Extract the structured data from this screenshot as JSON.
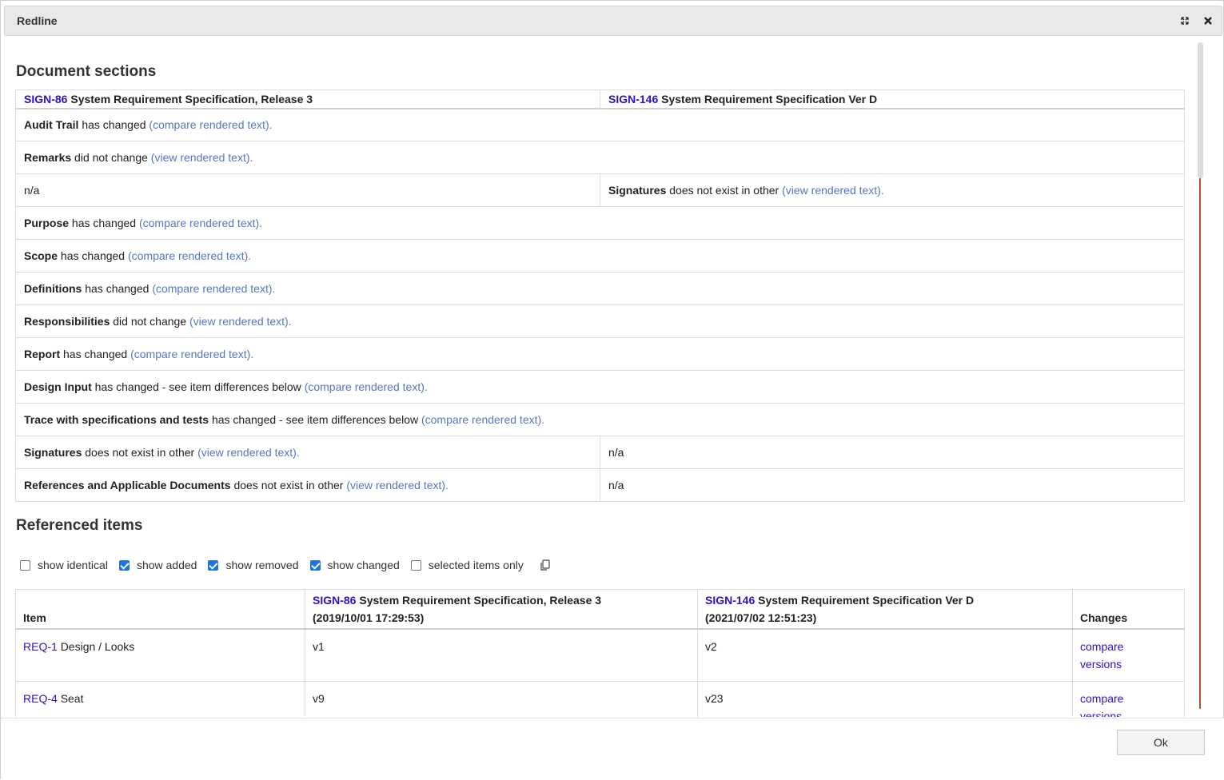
{
  "dialog": {
    "title": "Redline",
    "ok_label": "Ok"
  },
  "sections": {
    "heading": "Document sections",
    "left_doc": {
      "id": "SIGN-86",
      "title": "System Requirement Specification, Release 3"
    },
    "right_doc": {
      "id": "SIGN-146",
      "title": "System Requirement Specification Ver D"
    },
    "rows": [
      {
        "name": "Audit Trail",
        "status": "has changed",
        "link": "(compare rendered text)."
      },
      {
        "name": "Remarks",
        "status": "did not change",
        "link": "(view rendered text)."
      },
      {
        "left": "n/a",
        "name": "Signatures",
        "status": "does not exist in other",
        "link": "(view rendered text)."
      },
      {
        "name": "Purpose",
        "status": "has changed",
        "link": "(compare rendered text)."
      },
      {
        "name": "Scope",
        "status": "has changed",
        "link": "(compare rendered text)."
      },
      {
        "name": "Definitions",
        "status": "has changed",
        "link": "(compare rendered text)."
      },
      {
        "name": "Responsibilities",
        "status": "did not change",
        "link": "(view rendered text)."
      },
      {
        "name": "Report",
        "status": "has changed",
        "link": "(compare rendered text)."
      },
      {
        "name": "Design Input",
        "status": "has changed - see item differences below",
        "link": "(compare rendered text)."
      },
      {
        "name": "Trace with specifications and tests",
        "status": "has changed - see item differences below",
        "link": "(compare rendered text)."
      },
      {
        "name": "Signatures",
        "status": "does not exist in other",
        "link": "(view rendered text).",
        "right": "n/a"
      },
      {
        "name": "References and Applicable Documents",
        "status": "does not exist in other",
        "link": "(view rendered text).",
        "right": "n/a"
      }
    ]
  },
  "referenced": {
    "heading": "Referenced items",
    "filters": [
      {
        "label": "show identical",
        "checked": false
      },
      {
        "label": "show added",
        "checked": true
      },
      {
        "label": "show removed",
        "checked": true
      },
      {
        "label": "show changed",
        "checked": true
      },
      {
        "label": "selected items only",
        "checked": false
      }
    ],
    "columns": {
      "item": "Item",
      "left_id": "SIGN-86",
      "left_title": "System Requirement Specification, Release 3",
      "left_date": "(2019/10/01 17:29:53)",
      "right_id": "SIGN-146",
      "right_title": "System Requirement Specification Ver D",
      "right_date": "(2021/07/02 12:51:23)",
      "changes": "Changes"
    },
    "rows": [
      {
        "id": "REQ-1",
        "name": "Design / Looks",
        "left": "v1",
        "right": "v2",
        "action1": "compare",
        "action2": "versions"
      },
      {
        "id": "REQ-4",
        "name": "Seat",
        "left": "v9",
        "right": "v23",
        "action1": "compare",
        "action2": "versions"
      }
    ]
  }
}
